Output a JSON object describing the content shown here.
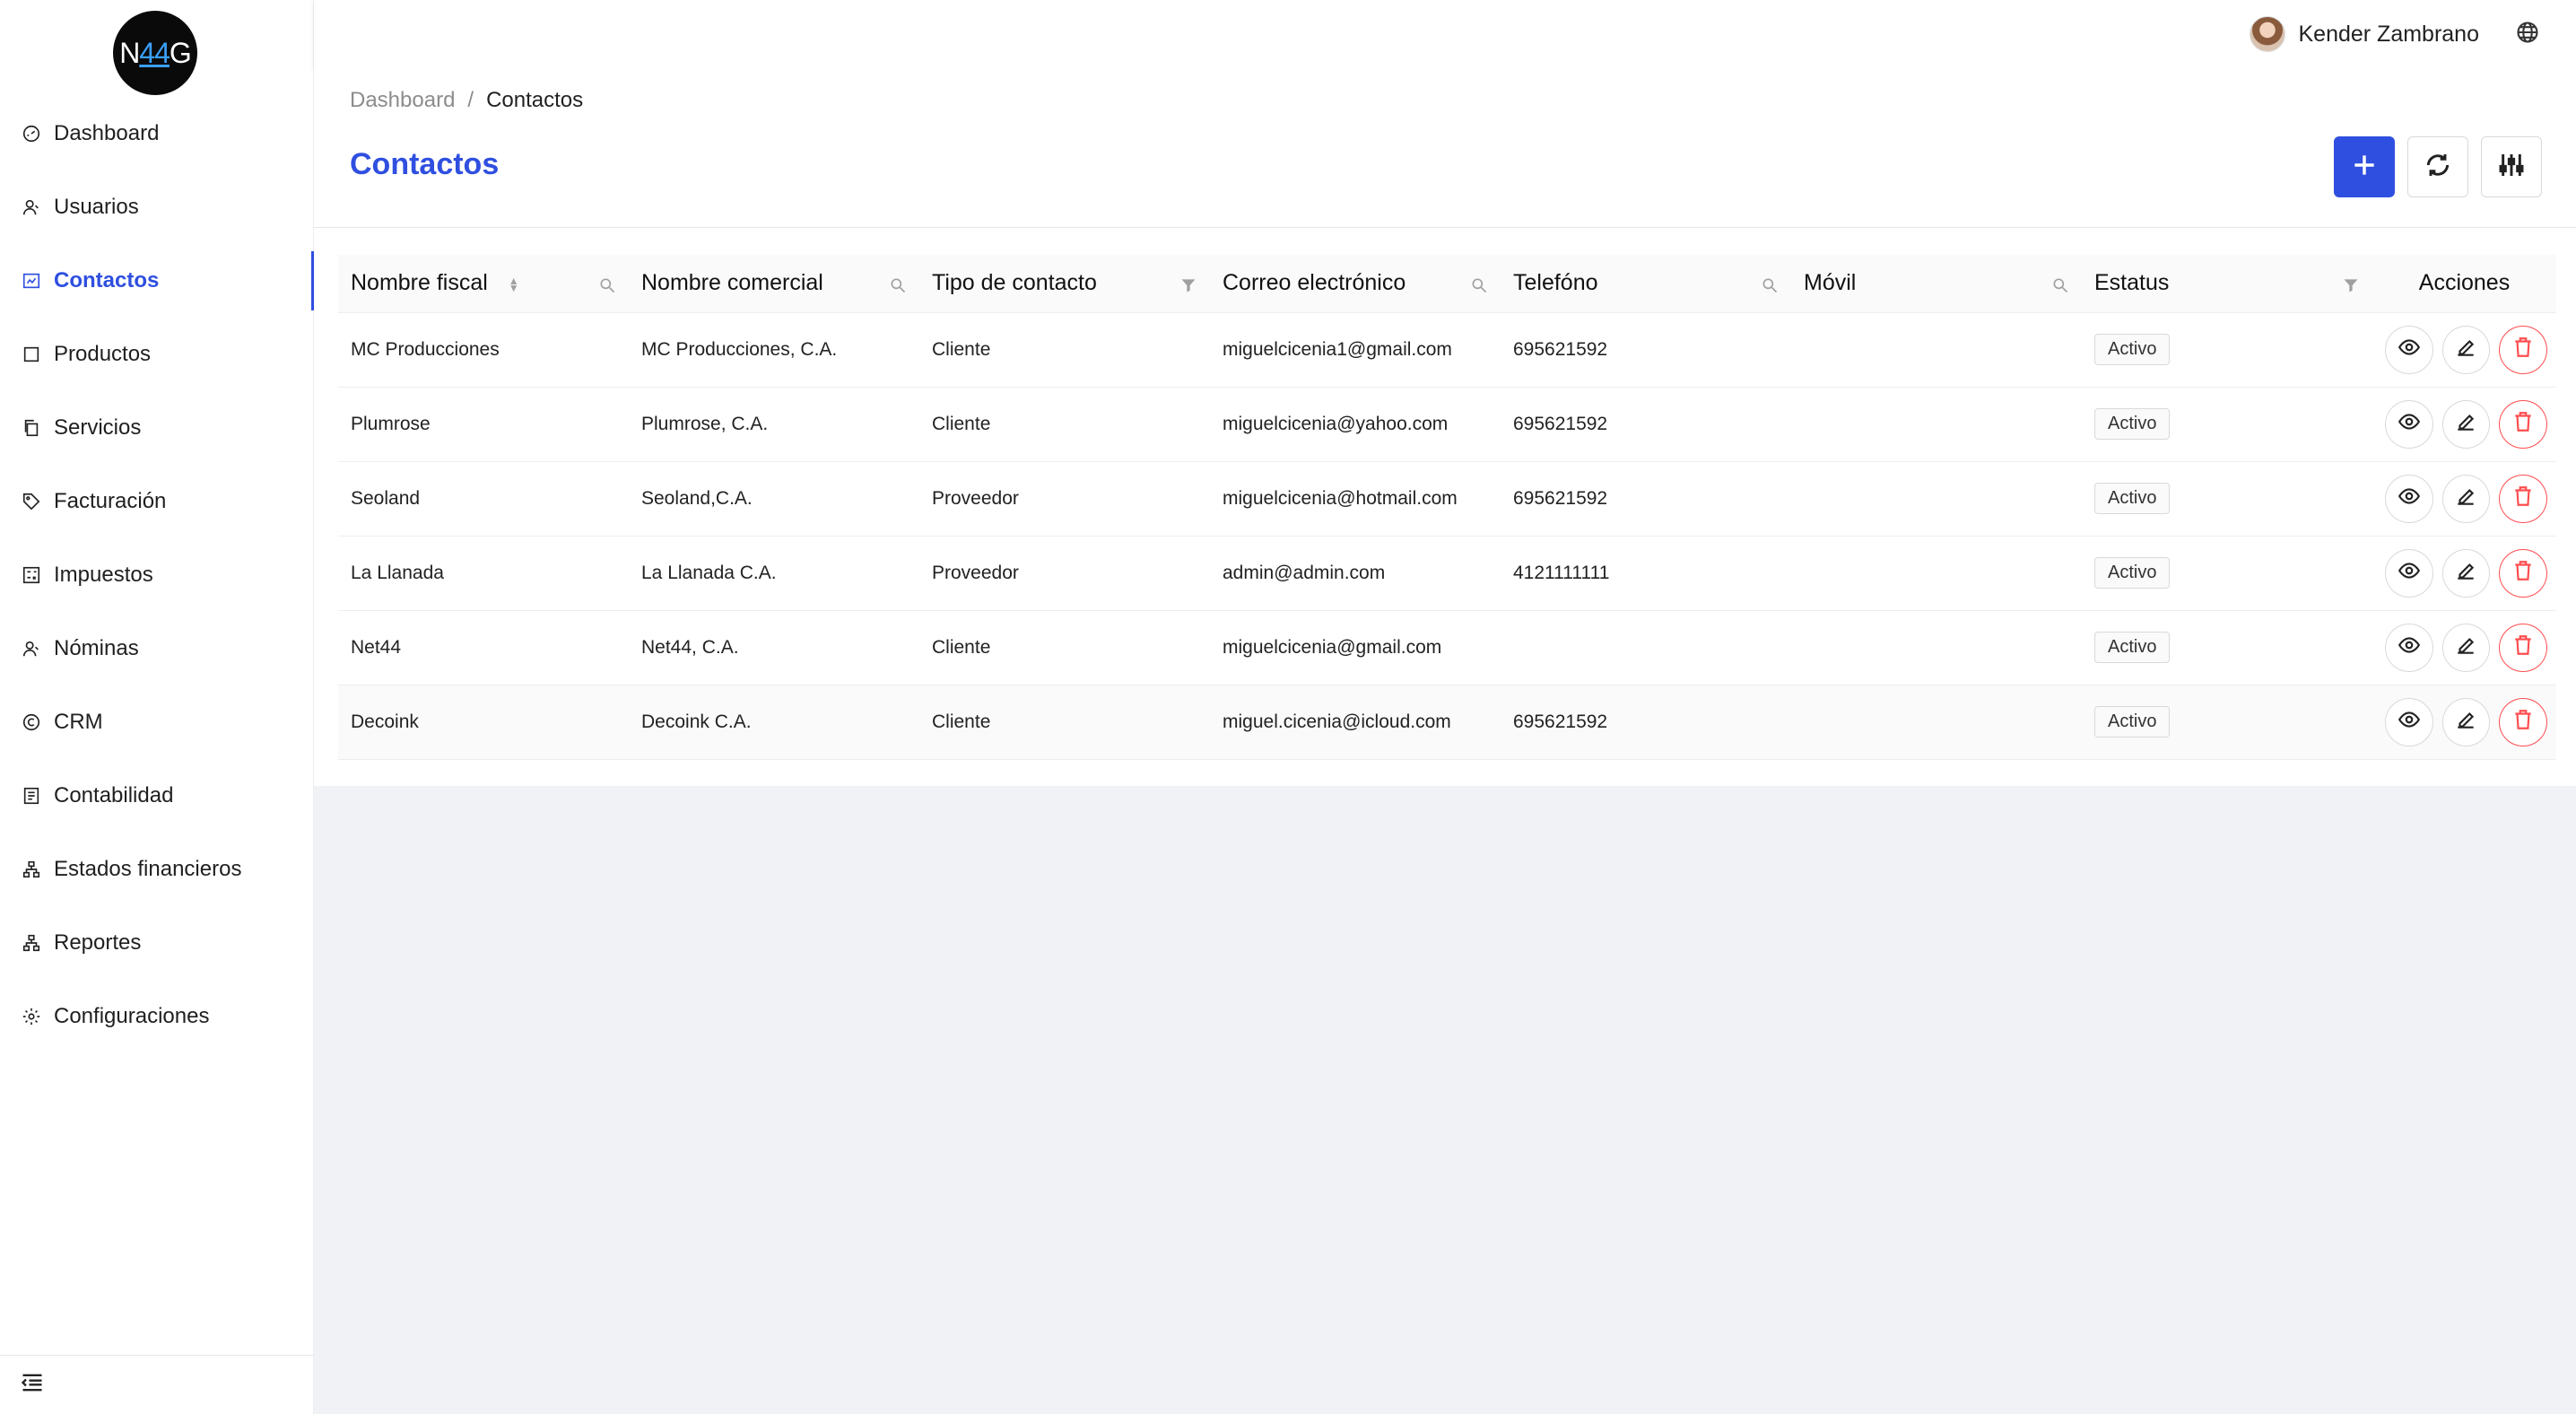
{
  "app": {
    "logo_prefix": "N",
    "logo_number": "44",
    "logo_suffix": "G"
  },
  "sidebar": {
    "items": [
      {
        "label": "Dashboard",
        "icon": "dashboard-icon"
      },
      {
        "label": "Usuarios",
        "icon": "users-icon"
      },
      {
        "label": "Contactos",
        "icon": "contacts-icon",
        "active": true
      },
      {
        "label": "Productos",
        "icon": "box-icon"
      },
      {
        "label": "Servicios",
        "icon": "copy-icon"
      },
      {
        "label": "Facturación",
        "icon": "tag-icon"
      },
      {
        "label": "Impuestos",
        "icon": "calculator-icon"
      },
      {
        "label": "Nóminas",
        "icon": "person-icon"
      },
      {
        "label": "CRM",
        "icon": "copyright-icon"
      },
      {
        "label": "Contabilidad",
        "icon": "ledger-icon"
      },
      {
        "label": "Estados financieros",
        "icon": "hierarchy-icon"
      },
      {
        "label": "Reportes",
        "icon": "hierarchy-icon"
      },
      {
        "label": "Configuraciones",
        "icon": "gear-icon"
      }
    ]
  },
  "header": {
    "user_name": "Kender Zambrano"
  },
  "page": {
    "breadcrumb_root": "Dashboard",
    "breadcrumb_sep": "/",
    "breadcrumb_current": "Contactos",
    "title": "Contactos"
  },
  "table": {
    "columns": [
      "Nombre fiscal",
      "Nombre comercial",
      "Tipo de contacto",
      "Correo electrónico",
      "Telefóno",
      "Móvil",
      "Estatus",
      "Acciones"
    ],
    "rows": [
      {
        "fiscal": "MC Producciones",
        "comercial": "MC Producciones, C.A.",
        "tipo": "Cliente",
        "correo": "miguelcicenia1@gmail.com",
        "telefono": "695621592",
        "movil": "",
        "estatus": "Activo"
      },
      {
        "fiscal": "Plumrose",
        "comercial": "Plumrose, C.A.",
        "tipo": "Cliente",
        "correo": "miguelcicenia@yahoo.com",
        "telefono": "695621592",
        "movil": "",
        "estatus": "Activo"
      },
      {
        "fiscal": "Seoland",
        "comercial": "Seoland,C.A.",
        "tipo": "Proveedor",
        "correo": "miguelcicenia@hotmail.com",
        "telefono": "695621592",
        "movil": "",
        "estatus": "Activo"
      },
      {
        "fiscal": "La Llanada",
        "comercial": "La Llanada C.A.",
        "tipo": "Proveedor",
        "correo": "admin@admin.com",
        "telefono": "4121111111",
        "movil": "",
        "estatus": "Activo"
      },
      {
        "fiscal": "Net44",
        "comercial": "Net44, C.A.",
        "tipo": "Cliente",
        "correo": "miguelcicenia@gmail.com",
        "telefono": "",
        "movil": "",
        "estatus": "Activo"
      },
      {
        "fiscal": "Decoink",
        "comercial": "Decoink C.A.",
        "tipo": "Cliente",
        "correo": "miguel.cicenia@icloud.com",
        "telefono": "695621592",
        "movil": "",
        "estatus": "Activo"
      }
    ]
  },
  "colors": {
    "accent": "#2f4fe0",
    "danger": "#ff4d4f"
  }
}
